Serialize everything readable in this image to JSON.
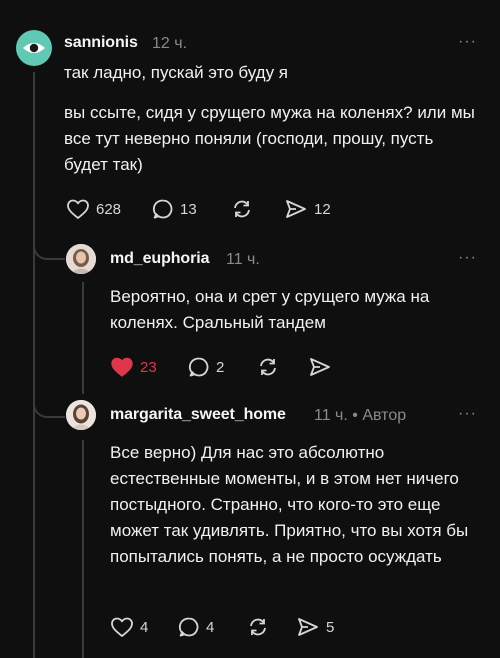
{
  "posts": [
    {
      "username": "sannionis",
      "time": "12 ч.",
      "paragraphs": [
        "так ладно, пускай это буду я",
        "вы ссыте, сидя у срущего мужа на коленях? или мы все тут неверно поняли (господи, прошу, пусть будет так)"
      ],
      "likes": "628",
      "replies": "13",
      "reposts": "",
      "shares": "12",
      "liked": false
    },
    {
      "username": "md_euphoria",
      "time": "11 ч.",
      "paragraphs": [
        "Вероятно, она и срет у срущего мужа на коленях. Сральный тандем"
      ],
      "likes": "23",
      "replies": "2",
      "reposts": "",
      "shares": "",
      "liked": true
    },
    {
      "username": "margarita_sweet_home",
      "time": "11 ч.",
      "author_badge": "• Автор",
      "paragraphs": [
        "Все верно) Для нас это абсолютно естественные моменты, и в этом нет ничего постыдного. Странно, что кого-то это еще может так удивлять. Приятно, что вы хотя бы попытались понять, а не просто осуждать"
      ],
      "likes": "4",
      "replies": "4",
      "reposts": "",
      "shares": "5",
      "liked": false
    }
  ],
  "more_label": "···",
  "colors": {
    "background": "#0f0f0f",
    "accent_like": "#e0364a",
    "avatar1": "#5fc9b4"
  }
}
